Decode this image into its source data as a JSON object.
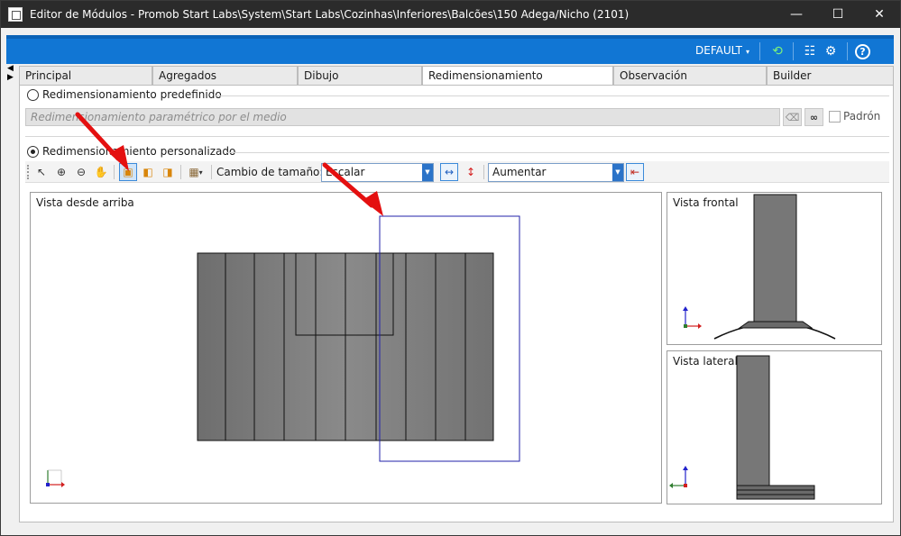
{
  "window": {
    "title": "Editor de Módulos - Promob Start Labs\\System\\Start Labs\\Cozinhas\\Inferiores\\Balcões\\150 Adega/Nicho (2101)",
    "minimize_glyph": "—",
    "maximize_glyph": "☐",
    "close_glyph": "✕"
  },
  "header": {
    "profile_label": "DEFAULT",
    "profile_caret": "▾",
    "refresh_glyph": "⟲",
    "list_glyph": "☷",
    "settings_glyph": "⚙",
    "help_glyph": "?"
  },
  "side_arrows": {
    "up": "◀",
    "down": "▶"
  },
  "tabs": [
    {
      "label": "Principal"
    },
    {
      "label": "Agregados"
    },
    {
      "label": "Dibujo"
    },
    {
      "label": "Redimensionamiento"
    },
    {
      "label": "Observación"
    },
    {
      "label": "Builder"
    }
  ],
  "predefined": {
    "label": "Redimensionamiento predefinido",
    "placeholder": "Redimensionamiento paramétrico por el medio",
    "eraser_glyph": "⌫",
    "binoculars_glyph": "∞",
    "default_label": "Padrón"
  },
  "custom": {
    "label": "Redimensionamiento personalizado",
    "toolbar": {
      "select_glyph": "↖",
      "zoom_in_glyph": "⊕",
      "zoom_out_glyph": "⊖",
      "pan_glyph": "✋",
      "rect_a_glyph": "▣",
      "rect_b_glyph": "◧",
      "rect_c_glyph": "◨",
      "cube_glyph": "▦",
      "cube_caret": "▾",
      "change_size_label": "Cambio de tamaño:",
      "mode_value": "Escalar",
      "dd_glyph": "▼",
      "horiz_glyph": "↔",
      "vert_glyph": "↕",
      "direction_value": "Aumentar",
      "apply_glyph": "⇤"
    }
  },
  "views": {
    "top": "Vista desde arriba",
    "front": "Vista frontal",
    "side": "Vista lateral"
  }
}
